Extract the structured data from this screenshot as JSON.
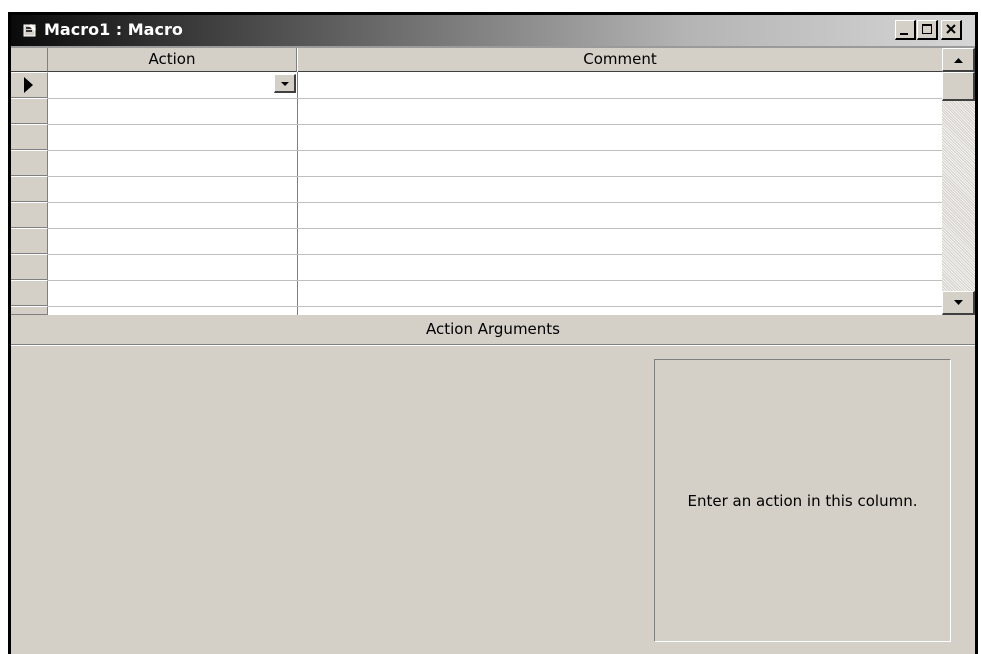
{
  "window": {
    "title": "Macro1 : Macro",
    "icon": "macro-icon",
    "controls": [
      "minimize-icon",
      "maximize-icon",
      "close-icon"
    ]
  },
  "grid": {
    "columns": [
      {
        "label": "Action"
      },
      {
        "label": "Comment"
      }
    ],
    "current_row": {
      "action": "",
      "comment": ""
    },
    "row_selector_icon": "current-row-arrow-icon"
  },
  "arguments": {
    "heading": "Action Arguments",
    "hint": "Enter an action in this column."
  }
}
